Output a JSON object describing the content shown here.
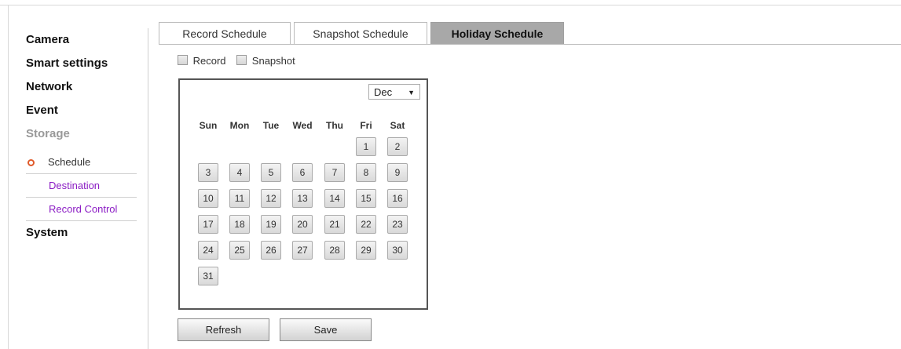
{
  "sidebar": {
    "camera": "Camera",
    "smart_settings": "Smart settings",
    "network": "Network",
    "event": "Event",
    "storage": "Storage",
    "storage_items": [
      "Schedule",
      "Destination",
      "Record Control"
    ],
    "system": "System"
  },
  "tabs": [
    "Record Schedule",
    "Snapshot Schedule",
    "Holiday Schedule"
  ],
  "checkboxes": {
    "record": "Record",
    "snapshot": "Snapshot"
  },
  "calendar": {
    "month": "Dec",
    "weekdays": [
      "Sun",
      "Mon",
      "Tue",
      "Wed",
      "Thu",
      "Fri",
      "Sat"
    ],
    "days": [
      [
        "",
        "",
        "",
        "",
        "",
        "1",
        "2"
      ],
      [
        "3",
        "4",
        "5",
        "6",
        "7",
        "8",
        "9"
      ],
      [
        "10",
        "11",
        "12",
        "13",
        "14",
        "15",
        "16"
      ],
      [
        "17",
        "18",
        "19",
        "20",
        "21",
        "22",
        "23"
      ],
      [
        "24",
        "25",
        "26",
        "27",
        "28",
        "29",
        "30"
      ],
      [
        "31",
        "",
        "",
        "",
        "",
        "",
        ""
      ]
    ]
  },
  "buttons": {
    "refresh": "Refresh",
    "save": "Save"
  },
  "colors": {
    "link": "#8b1cc4",
    "active_tab": "#a8a8a8",
    "bullet": "#e05a2a"
  }
}
